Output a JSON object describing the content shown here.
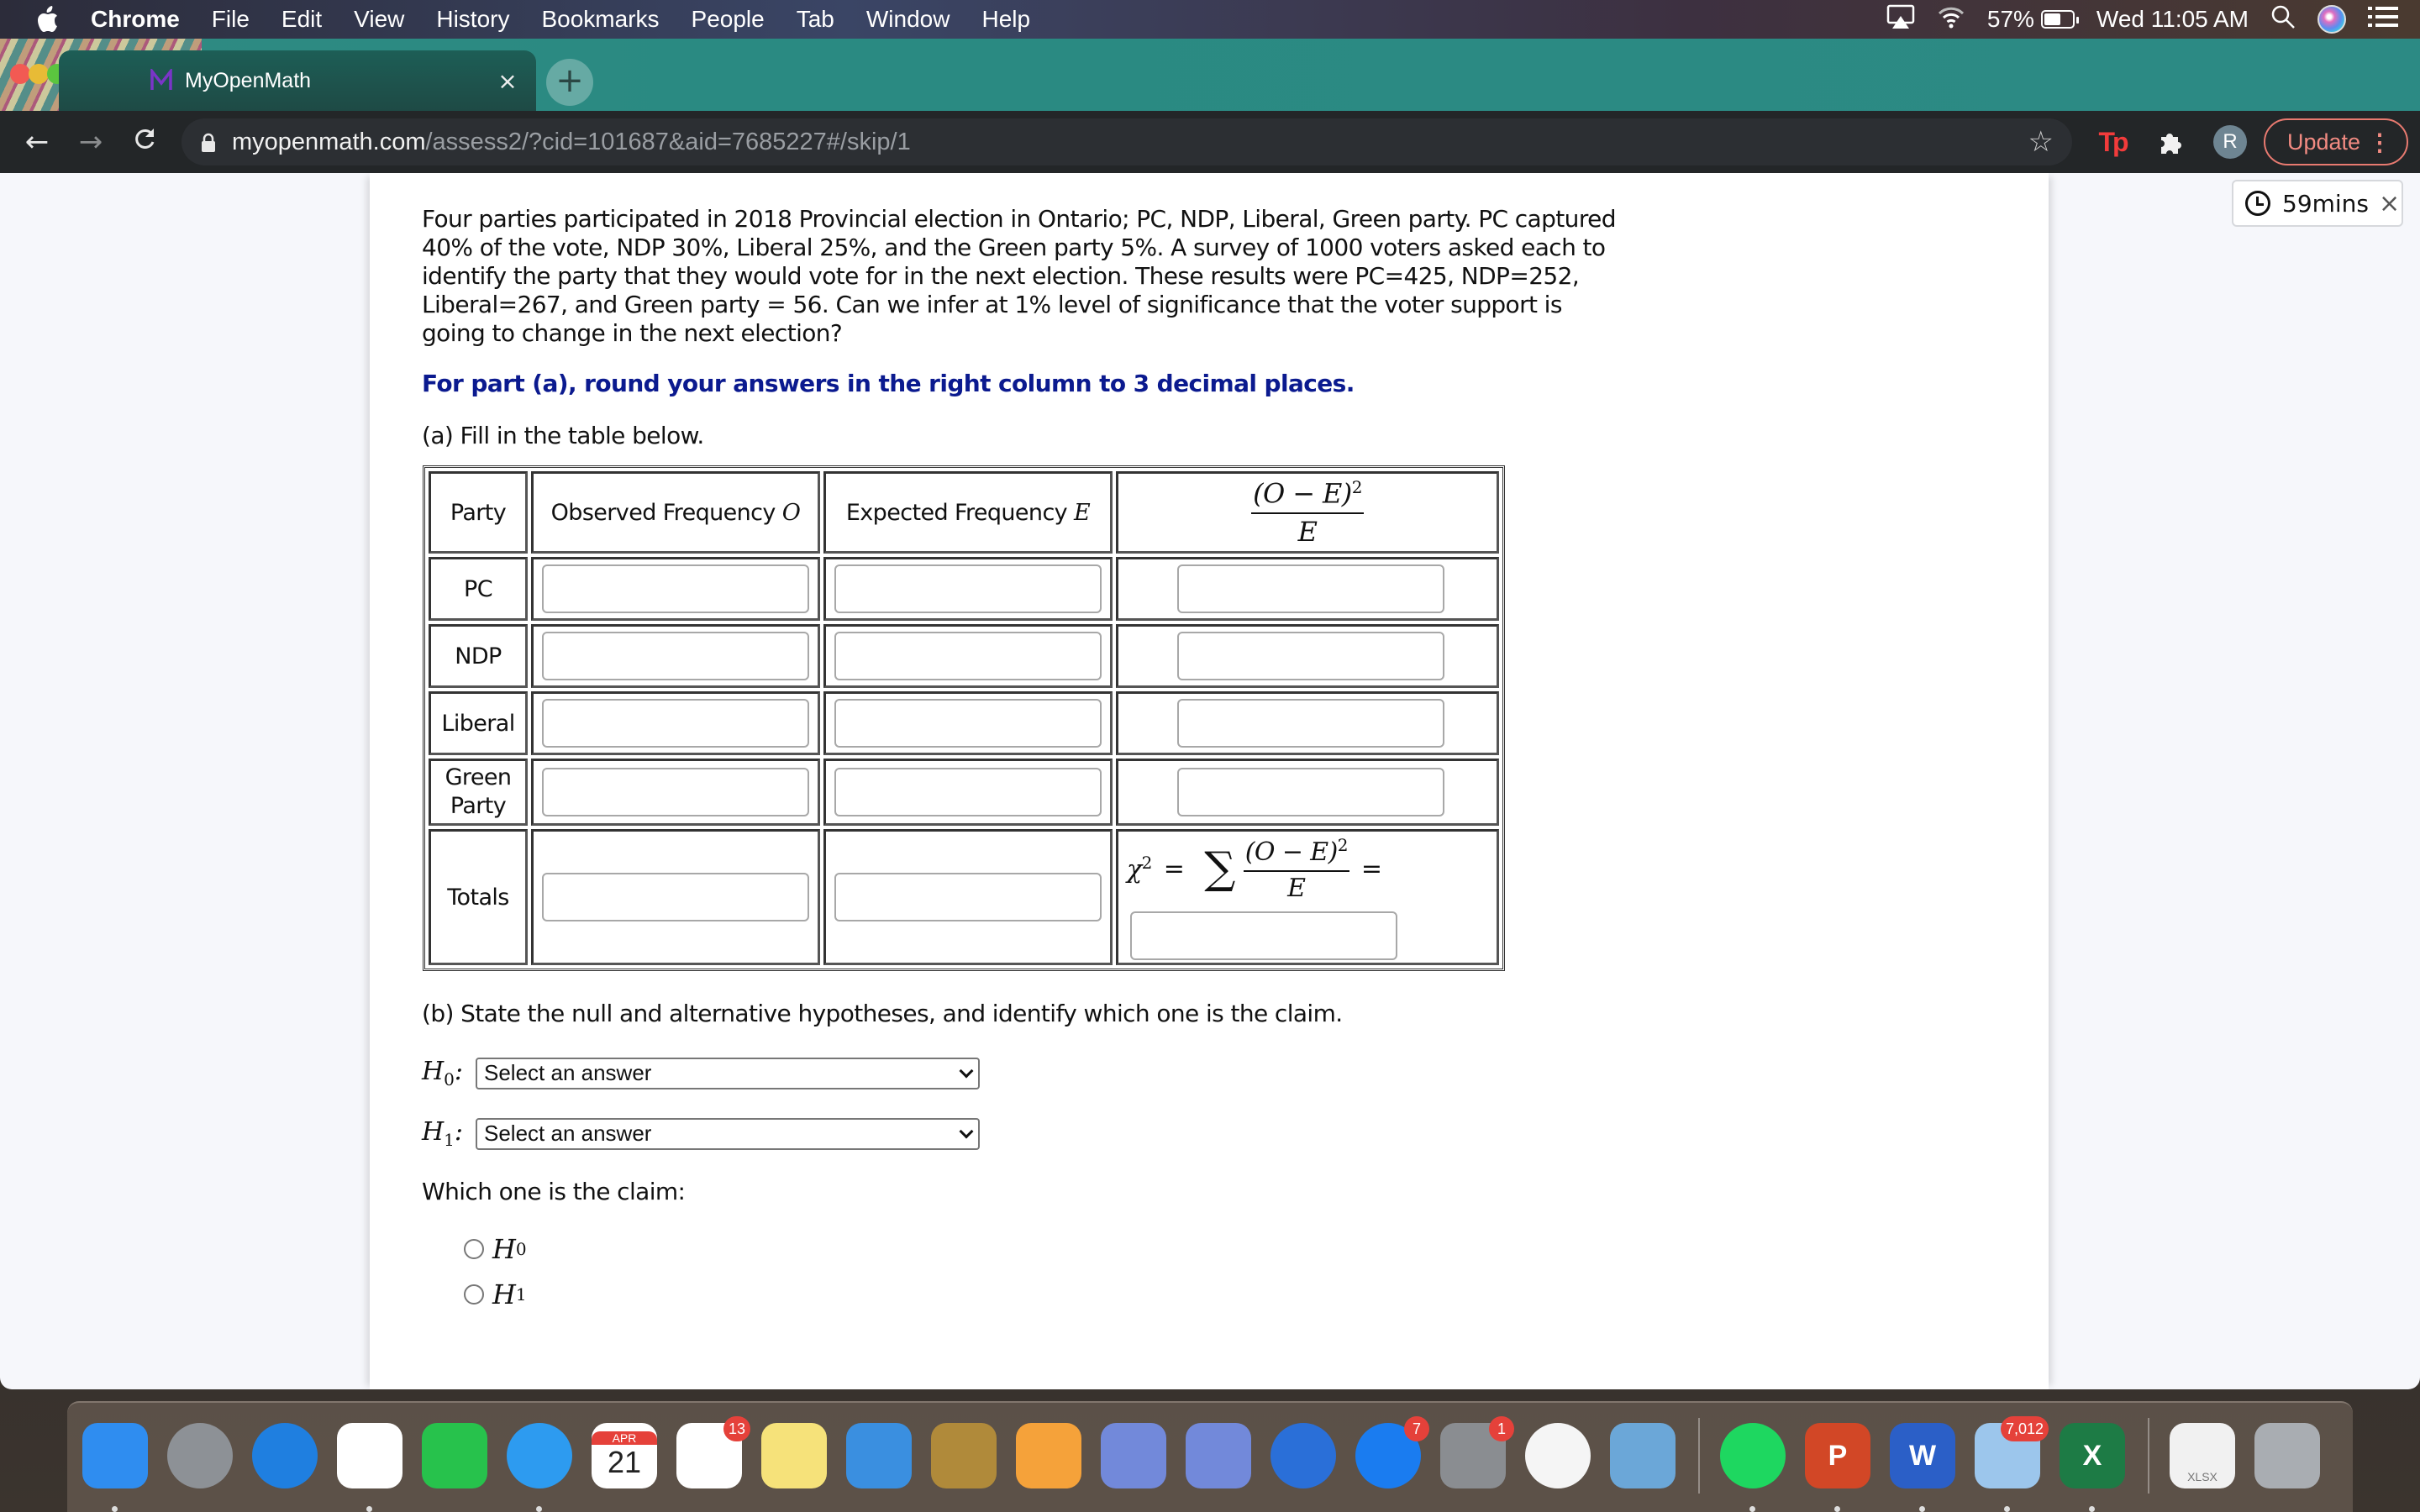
{
  "menubar": {
    "app_name": "Chrome",
    "menus": [
      "File",
      "Edit",
      "View",
      "History",
      "Bookmarks",
      "People",
      "Tab",
      "Window",
      "Help"
    ],
    "battery_percent": "57%",
    "clock": "Wed 11:05 AM"
  },
  "browser": {
    "tab_title": "MyOpenMath",
    "tab_close": "×",
    "new_tab": "+",
    "url_host": "myopenmath.com",
    "url_path": "/assess2/?cid=101687&aid=7685227#/skip/1",
    "profile_initial": "R",
    "update_label": "Update",
    "extension_tp": "Tp"
  },
  "timer": {
    "label": "59mins",
    "close": "×"
  },
  "question": {
    "paragraph": "Four parties participated in 2018 Provincial election in Ontario; PC, NDP, Liberal, Green party. PC captured 40% of the vote, NDP 30%, Liberal 25%, and the Green party 5%. A survey of 1000 voters asked each to identify the party that they would vote for in the next election. These results were PC=425, NDP=252, Liberal=267, and Green party = 56. Can we infer at 1% level of significance that the voter support is going to change in the next election?",
    "instruction": "For part (a), round your answers in the right column to 3 decimal places.",
    "part_a": "(a) Fill in the table below."
  },
  "table": {
    "headers": {
      "party": "Party",
      "observed": "Observed Frequency",
      "observed_symbol": "O",
      "expected": "Expected Frequency",
      "expected_symbol": "E",
      "residual_numerator": "(O − E)",
      "residual_exponent": "2",
      "residual_denominator": "E"
    },
    "rows": [
      {
        "party": "PC",
        "observed": "",
        "expected": "",
        "residual": ""
      },
      {
        "party": "NDP",
        "observed": "",
        "expected": "",
        "residual": ""
      },
      {
        "party": "Liberal",
        "observed": "",
        "expected": "",
        "residual": ""
      },
      {
        "party": "Green Party",
        "observed": "",
        "expected": "",
        "residual": ""
      }
    ],
    "totals": {
      "label": "Totals",
      "observed": "",
      "expected": "",
      "chi_symbol": "χ",
      "chi_exponent": "2",
      "equals": "=",
      "sum_symbol": "∑",
      "chi_value": ""
    }
  },
  "part_b": {
    "prompt": "(b) State the null and alternative hypotheses, and identify which one is the claim.",
    "h0_label": "H",
    "h0_sub": "0",
    "h1_label": "H",
    "h1_sub": "1",
    "h0_select": "Select an answer",
    "h1_select": "Select an answer",
    "claim_prompt": "Which one is the claim:",
    "claim_options": [
      {
        "label": "H",
        "sub": "0",
        "selected": false
      },
      {
        "label": "H",
        "sub": "1",
        "selected": false
      }
    ]
  },
  "dock": {
    "apps": [
      {
        "name": "Finder",
        "color": "#2f8df0",
        "running": true
      },
      {
        "name": "Launchpad",
        "color": "#8d9196",
        "running": false
      },
      {
        "name": "Safari",
        "color": "#1f7fe0",
        "running": false
      },
      {
        "name": "Chrome",
        "color": "#ffffff",
        "running": true
      },
      {
        "name": "FaceTime",
        "color": "#27c24c",
        "running": false
      },
      {
        "name": "Messages",
        "color": "#2d9bf0",
        "running": true
      },
      {
        "name": "Calendar",
        "color": "#ffffff",
        "label": "21",
        "month": "APR",
        "running": false
      },
      {
        "name": "Reminders",
        "color": "#ffffff",
        "badge": "13",
        "running": false
      },
      {
        "name": "Notes",
        "color": "#f6e27a",
        "running": false
      },
      {
        "name": "Keynote",
        "color": "#3a8fe0",
        "running": false
      },
      {
        "name": "League of Legends",
        "color": "#b08a3a",
        "running": false
      },
      {
        "name": "Pages",
        "color": "#f5a23a",
        "running": false
      },
      {
        "name": "Discord",
        "color": "#7289da",
        "running": false
      },
      {
        "name": "Discord",
        "color": "#7289da",
        "running": false
      },
      {
        "name": "QuickTime Player",
        "color": "#2a6fd8",
        "running": false
      },
      {
        "name": "App Store",
        "color": "#1a7cf0",
        "badge": "7",
        "running": false
      },
      {
        "name": "System Preferences",
        "color": "#8a8d91",
        "badge": "1",
        "running": false
      },
      {
        "name": "Music",
        "color": "#f5f5f5",
        "running": false
      },
      {
        "name": "Preview",
        "color": "#6ba7d8",
        "running": false
      },
      {
        "name": "Spotify",
        "color": "#1ed760",
        "running": true
      },
      {
        "name": "PowerPoint",
        "color": "#d24726",
        "label": "P",
        "running": true
      },
      {
        "name": "Word",
        "color": "#2b5fc7",
        "label": "W",
        "running": true
      },
      {
        "name": "Mail",
        "color": "#9cc6ec",
        "badge": "7,012",
        "running": true
      },
      {
        "name": "Excel",
        "color": "#1d7b45",
        "label": "X",
        "running": true
      },
      {
        "name": "XLSX document",
        "color": "#f1f1f1",
        "label": "XLSX",
        "running": false
      },
      {
        "name": "Trash",
        "color": "#a9adb2",
        "running": false
      }
    ]
  }
}
